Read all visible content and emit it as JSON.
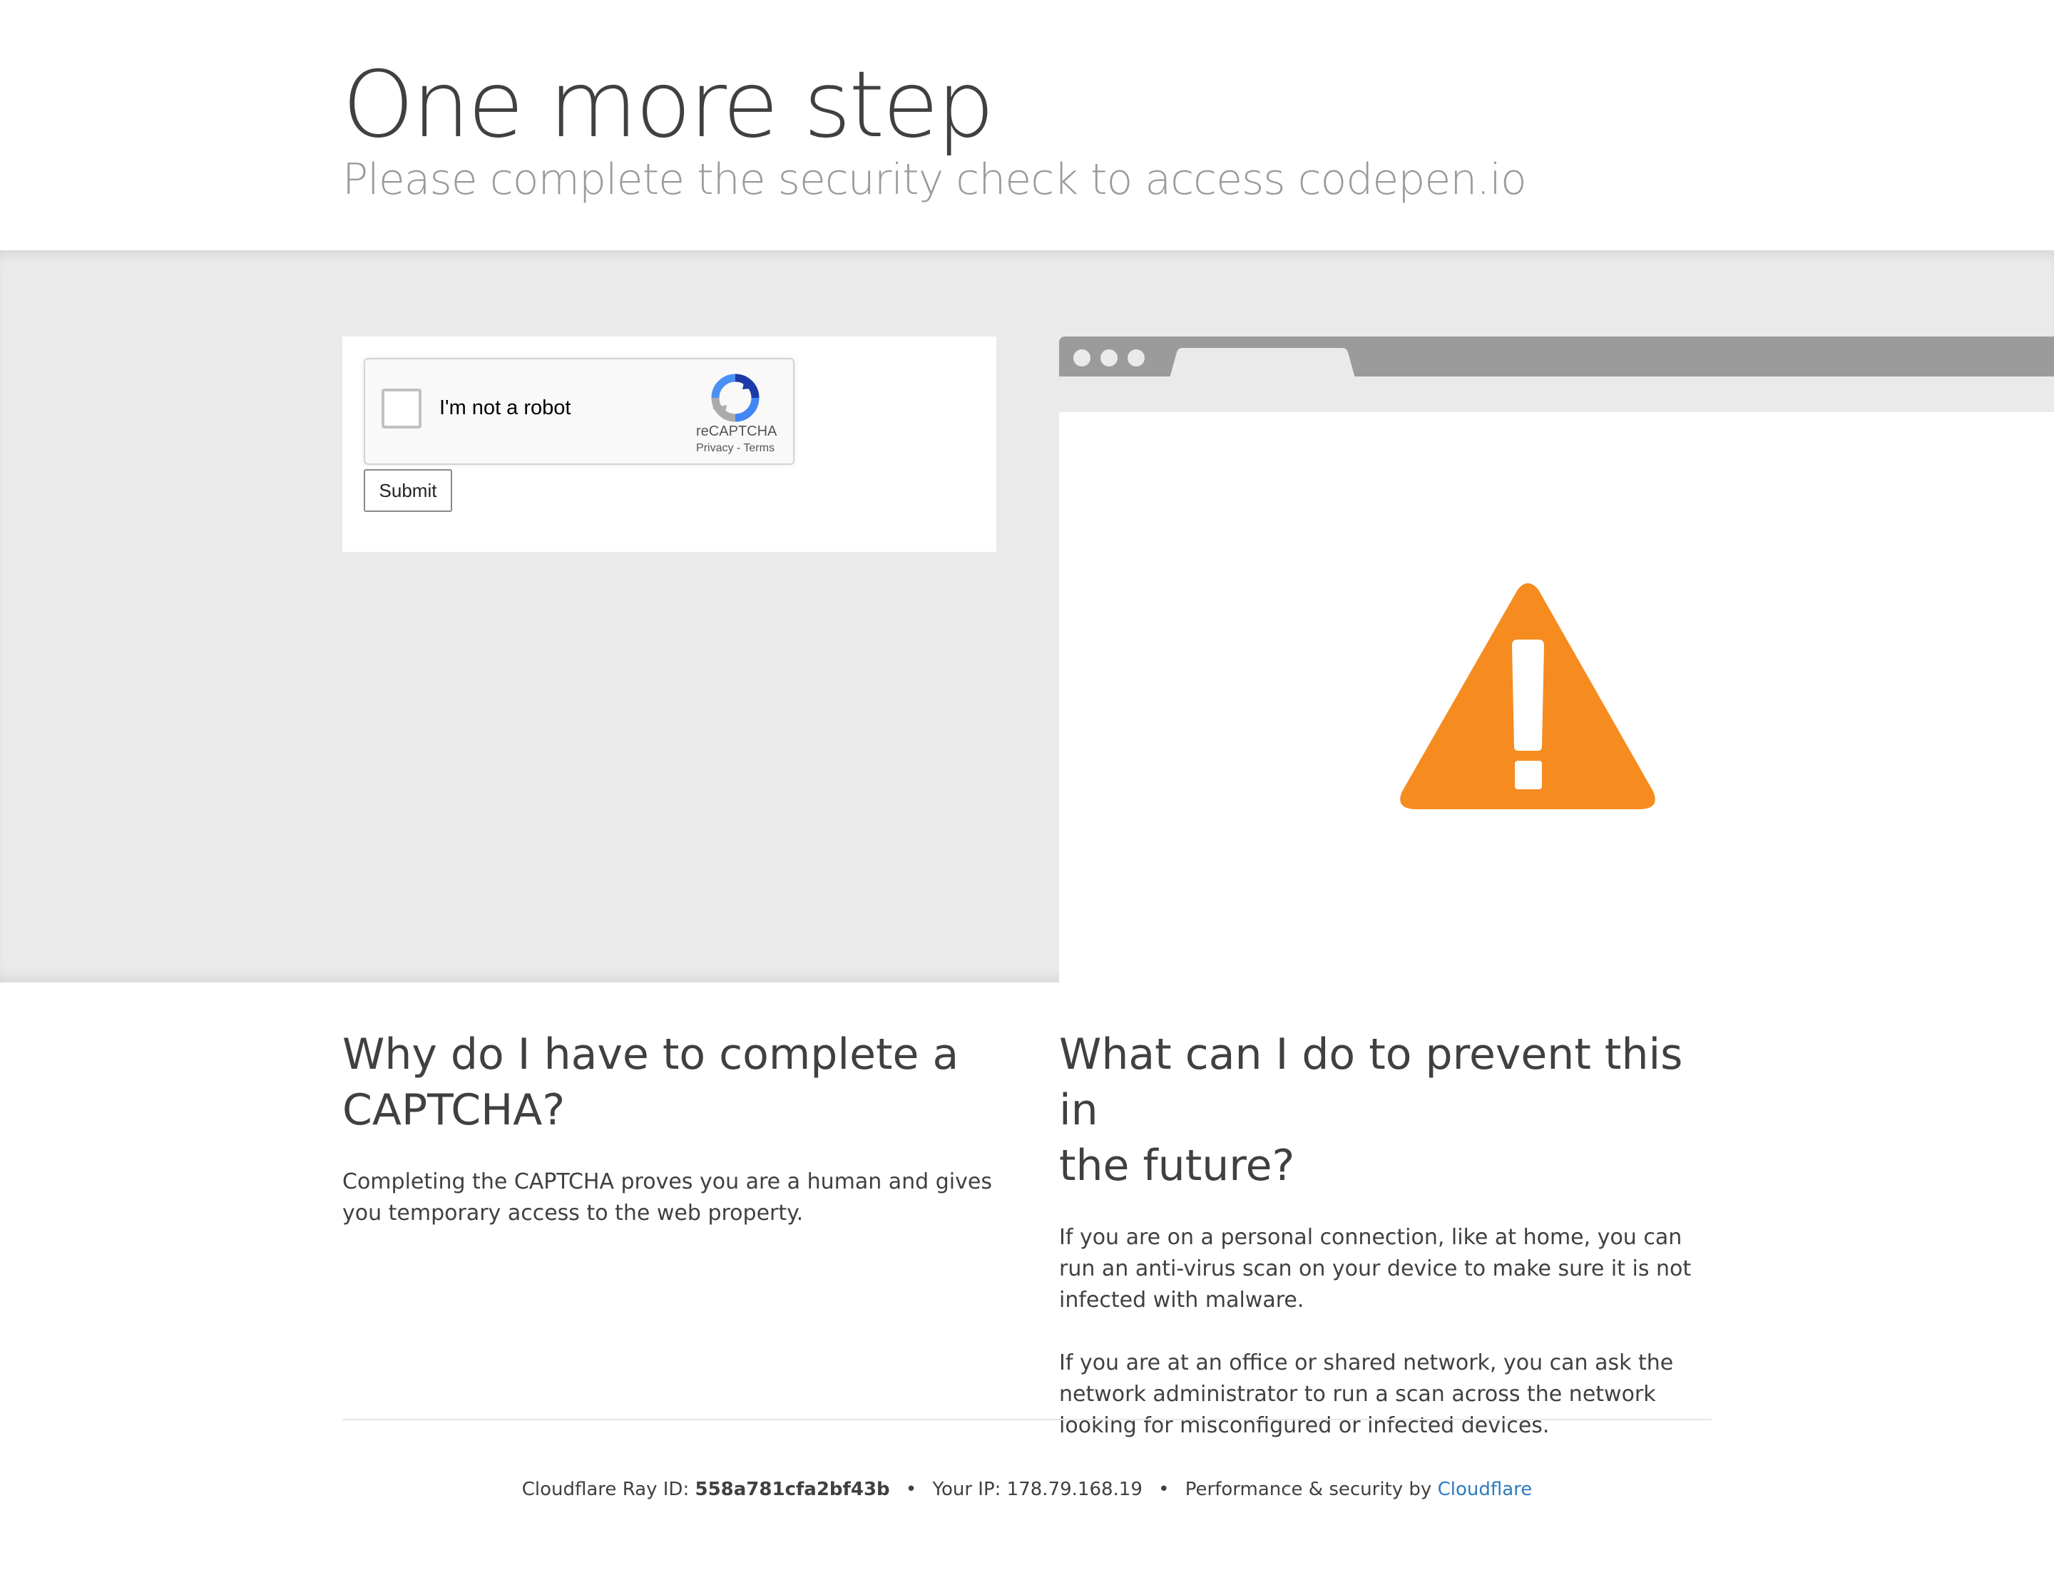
{
  "header": {
    "title": "One more step",
    "subtitle": "Please complete the security check to access codepen.io"
  },
  "captcha": {
    "checkbox_label": "I'm not a robot",
    "brand": "reCAPTCHA",
    "privacy_link": "Privacy",
    "link_separator": "-",
    "terms_link": "Terms",
    "submit_label": "Submit"
  },
  "illustration": {
    "icon": "warning-icon",
    "warning_color": "#f68b1f"
  },
  "why": {
    "heading_line1": "Why do I have to complete a",
    "heading_line2": "CAPTCHA?",
    "body": "Completing the CAPTCHA proves you are a human and gives you temporary access to the web property."
  },
  "prevent": {
    "heading_line1": "What can I do to prevent this in",
    "heading_line2": "the future?",
    "body1": "If you are on a personal connection, like at home, you can run an anti-virus scan on your device to make sure it is not infected with malware.",
    "body2": "If you are at an office or shared network, you can ask the network administrator to run a scan across the network looking for misconfigured or infected devices."
  },
  "footer": {
    "ray_label": "Cloudflare Ray ID:",
    "ray_id": "558a781cfa2bf43b",
    "bullet": "•",
    "ip_label": "Your IP:",
    "ip": "178.79.168.19",
    "perf_label": "Performance & security by",
    "perf_link": "Cloudflare",
    "link_color": "#2f7bbf"
  }
}
